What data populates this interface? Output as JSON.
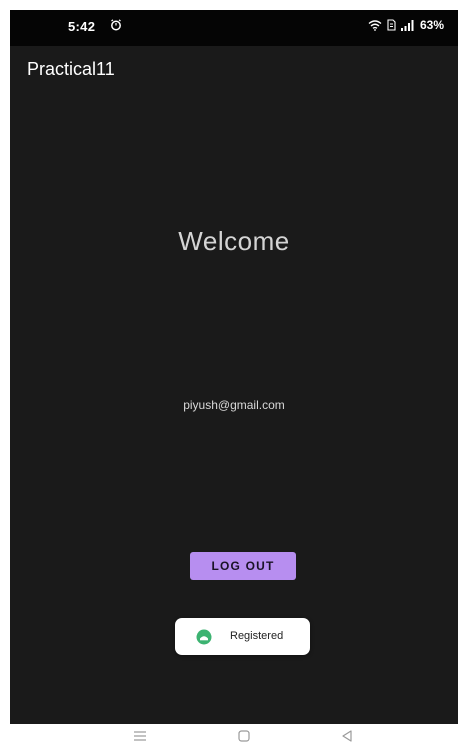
{
  "status_bar": {
    "time": "5:42",
    "battery": "63%",
    "icons": [
      "alarm-icon",
      "wifi-icon",
      "sim-icon",
      "signal-icon"
    ]
  },
  "app_bar": {
    "title": "Practical11"
  },
  "main": {
    "welcome": "Welcome",
    "email": "piyush@gmail.com",
    "logout_label": "LOG OUT"
  },
  "toast": {
    "message": "Registered",
    "icon": "app-icon"
  },
  "nav_bar": {
    "buttons": [
      "menu-icon",
      "home-icon",
      "back-icon"
    ]
  },
  "colors": {
    "background": "#1a1a1a",
    "status_bar": "#050505",
    "accent": "#b78ef0",
    "toast_icon": "#3cb371"
  }
}
